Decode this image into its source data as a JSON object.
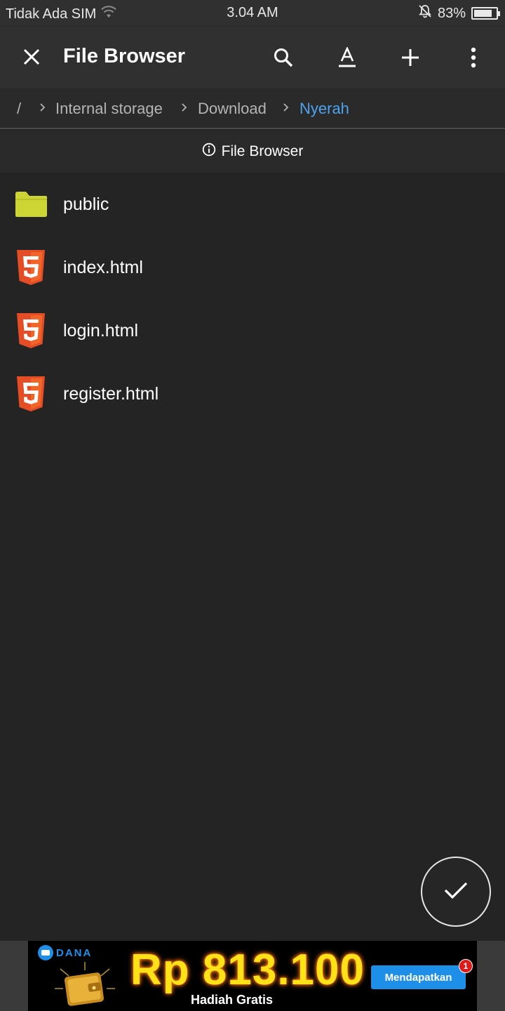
{
  "status_bar": {
    "carrier": "Tidak Ada SIM",
    "time": "3.04 AM",
    "battery": "83%",
    "battery_level": 0.83,
    "icons": [
      "wifi-icon",
      "alarm-off-icon",
      "battery-icon"
    ]
  },
  "toolbar": {
    "title": "File Browser",
    "icons": [
      "close-icon",
      "search-icon",
      "font-icon",
      "add-icon",
      "more-vert-icon"
    ]
  },
  "breadcrumb": {
    "root": "/",
    "items": [
      "Internal storage",
      "Download",
      "Nyerah"
    ]
  },
  "info_header": {
    "label": "File Browser",
    "icon": "info-icon"
  },
  "files": [
    {
      "name": "public",
      "type": "folder",
      "icon": "folder-icon"
    },
    {
      "name": "index.html",
      "type": "html",
      "icon": "html5-icon"
    },
    {
      "name": "login.html",
      "type": "html",
      "icon": "html5-icon"
    },
    {
      "name": "register.html",
      "type": "html",
      "icon": "html5-icon"
    }
  ],
  "fab": {
    "icon": "check-icon"
  },
  "ad": {
    "brand": "DANA",
    "amount": "Rp 813.100",
    "subtitle": "Hadiah Gratis",
    "cta": "Mendapatkan",
    "badge": "1"
  },
  "colors": {
    "background": "#242424",
    "toolbar": "#303030",
    "accent": "#4ea3ee",
    "folder": "#cdd535",
    "html5": "#e44d26"
  }
}
